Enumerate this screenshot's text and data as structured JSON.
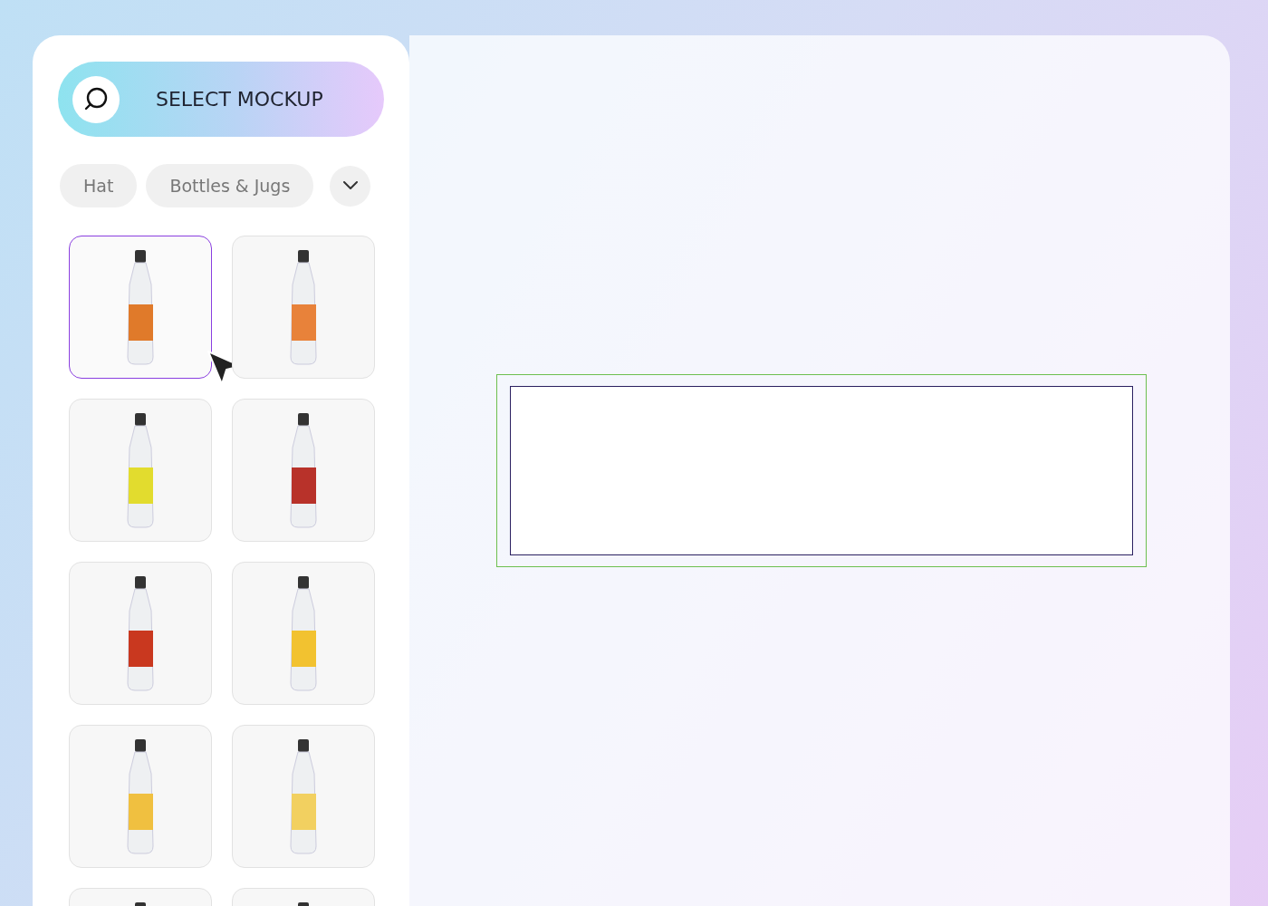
{
  "select_button": {
    "label": "SELECT MOCKUP"
  },
  "categories": [
    {
      "label": "Hat",
      "selected": false
    },
    {
      "label": "Bottles & Jugs",
      "selected": false
    }
  ],
  "mockups": [
    {
      "selected": true,
      "color": "#e07a2a"
    },
    {
      "selected": false,
      "color": "#e8823a"
    },
    {
      "selected": false,
      "color": "#e2dc2e"
    },
    {
      "selected": false,
      "color": "#b8322a"
    },
    {
      "selected": false,
      "color": "#c9381f"
    },
    {
      "selected": false,
      "color": "#f2c230"
    },
    {
      "selected": false,
      "color": "#f0c040"
    },
    {
      "selected": false,
      "color": "#f2d060"
    },
    {
      "selected": false
    },
    {
      "selected": false
    }
  ]
}
